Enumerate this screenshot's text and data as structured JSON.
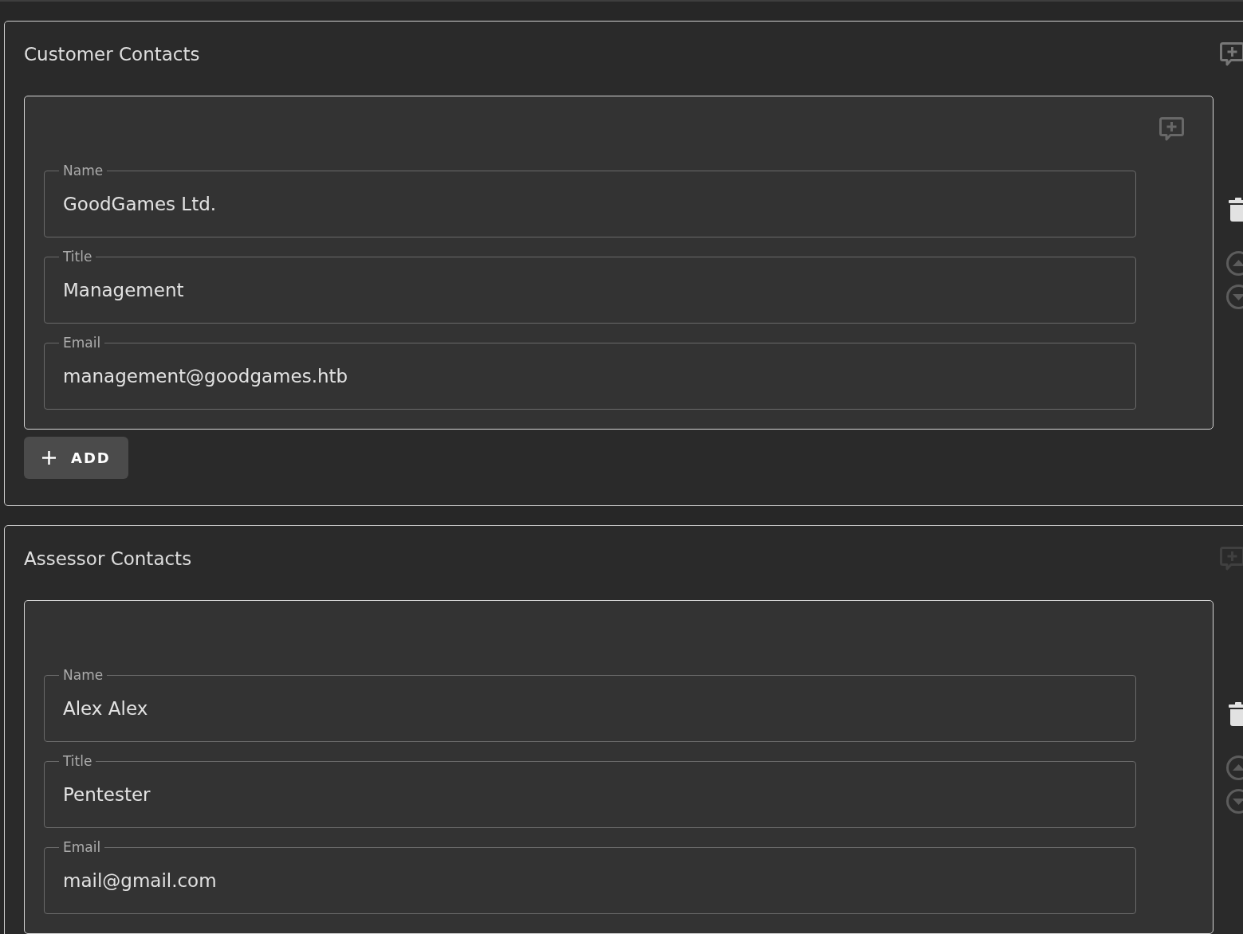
{
  "sections": [
    {
      "title": "Customer Contacts",
      "comment_disabled": false,
      "contacts": [
        {
          "comment_button": true,
          "move_up_disabled": true,
          "move_down_disabled": true,
          "fields": [
            {
              "label": "Name",
              "value": "GoodGames Ltd."
            },
            {
              "label": "Title",
              "value": "Management"
            },
            {
              "label": "Email",
              "value": "management@goodgames.htb"
            }
          ]
        }
      ],
      "add_button": {
        "label": "ADD"
      }
    },
    {
      "title": "Assessor Contacts",
      "comment_disabled": true,
      "contacts": [
        {
          "comment_button": false,
          "move_up_disabled": true,
          "move_down_disabled": true,
          "fields": [
            {
              "label": "Name",
              "value": "Alex Alex"
            },
            {
              "label": "Title",
              "value": "Pentester"
            },
            {
              "label": "Email",
              "value": "mail@gmail.com"
            }
          ]
        }
      ]
    }
  ]
}
